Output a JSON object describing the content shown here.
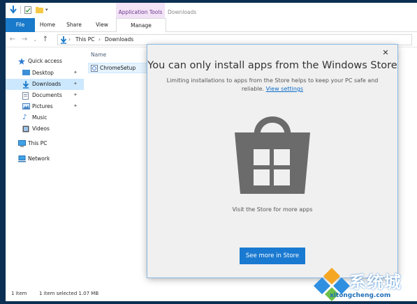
{
  "window": {
    "context_tab_group": "Application Tools",
    "title": "Downloads"
  },
  "ribbon": {
    "tabs": [
      "File",
      "Home",
      "Share",
      "View",
      "Manage"
    ]
  },
  "address": {
    "crumbs": [
      "This PC",
      "Downloads"
    ]
  },
  "nav_pane": {
    "items": [
      {
        "label": "Quick access",
        "icon": "star-icon",
        "pinned": false
      },
      {
        "label": "Desktop",
        "icon": "desktop-icon",
        "pinned": true
      },
      {
        "label": "Downloads",
        "icon": "download-icon",
        "pinned": true,
        "selected": true
      },
      {
        "label": "Documents",
        "icon": "documents-icon",
        "pinned": true
      },
      {
        "label": "Pictures",
        "icon": "pictures-icon",
        "pinned": true
      },
      {
        "label": "Music",
        "icon": "music-icon",
        "pinned": false
      },
      {
        "label": "Videos",
        "icon": "videos-icon",
        "pinned": false
      },
      {
        "label": "This PC",
        "icon": "computer-icon",
        "pinned": false
      },
      {
        "label": "Network",
        "icon": "network-icon",
        "pinned": false
      }
    ]
  },
  "content": {
    "column_header": "Name",
    "files": [
      {
        "name": "ChromeSetup",
        "icon": "installer-icon"
      }
    ]
  },
  "status": {
    "item_count": "1 item",
    "selection": "1 item selected  1.07 MB"
  },
  "dialog": {
    "title": "You can only install apps from the Windows Store",
    "body": "Limiting installations to apps from the Store helps to keep your PC safe and reliable.",
    "link": "View settings",
    "hint": "Visit the Store for more apps",
    "button": "See more in Store",
    "close_glyph": "✕"
  },
  "watermark": {
    "text": "系统城",
    "url": "xitongcheng.com"
  },
  "colors": {
    "accent": "#1979ca",
    "context_tab": "#f3e3f7",
    "selection": "#cce8ff",
    "store_button": "#1a7ad1"
  }
}
